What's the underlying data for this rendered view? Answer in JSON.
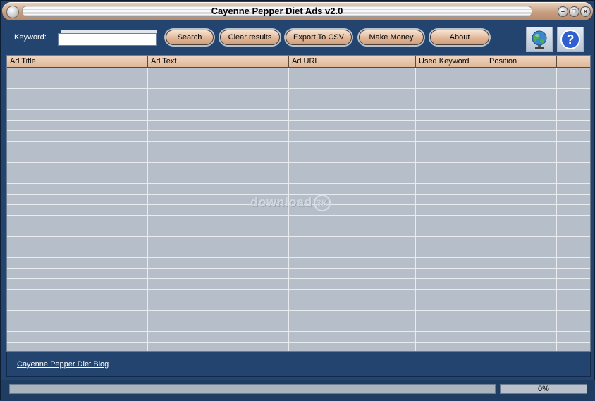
{
  "window": {
    "title": "Cayenne Pepper Diet Ads v2.0",
    "controls": {
      "minimize": "–",
      "maximize": "□",
      "close": "×"
    }
  },
  "toolbar": {
    "keyword_label": "Keyword:",
    "keyword_value": "",
    "buttons": {
      "search": "Search",
      "clear": "Clear results",
      "export": "Export To CSV",
      "money": "Make Money",
      "about": "About"
    },
    "icons": {
      "web": "globe-icon",
      "help": "help-icon"
    },
    "help_glyph": "?"
  },
  "table": {
    "columns": [
      "Ad Title",
      "Ad Text",
      "Ad URL",
      "Used Keyword",
      "Position"
    ],
    "rows": []
  },
  "watermark": {
    "text": "download",
    "badge": "3K"
  },
  "footer": {
    "blog_link": "Cayenne Pepper Diet Blog"
  },
  "status": {
    "progress_percent": 0,
    "progress_label": "0%"
  },
  "colors": {
    "window_bg": "#23446e",
    "header_bg": "#e3c2a7",
    "grid_bg": "#b6bfc9",
    "button_bg": "#e2b798"
  }
}
